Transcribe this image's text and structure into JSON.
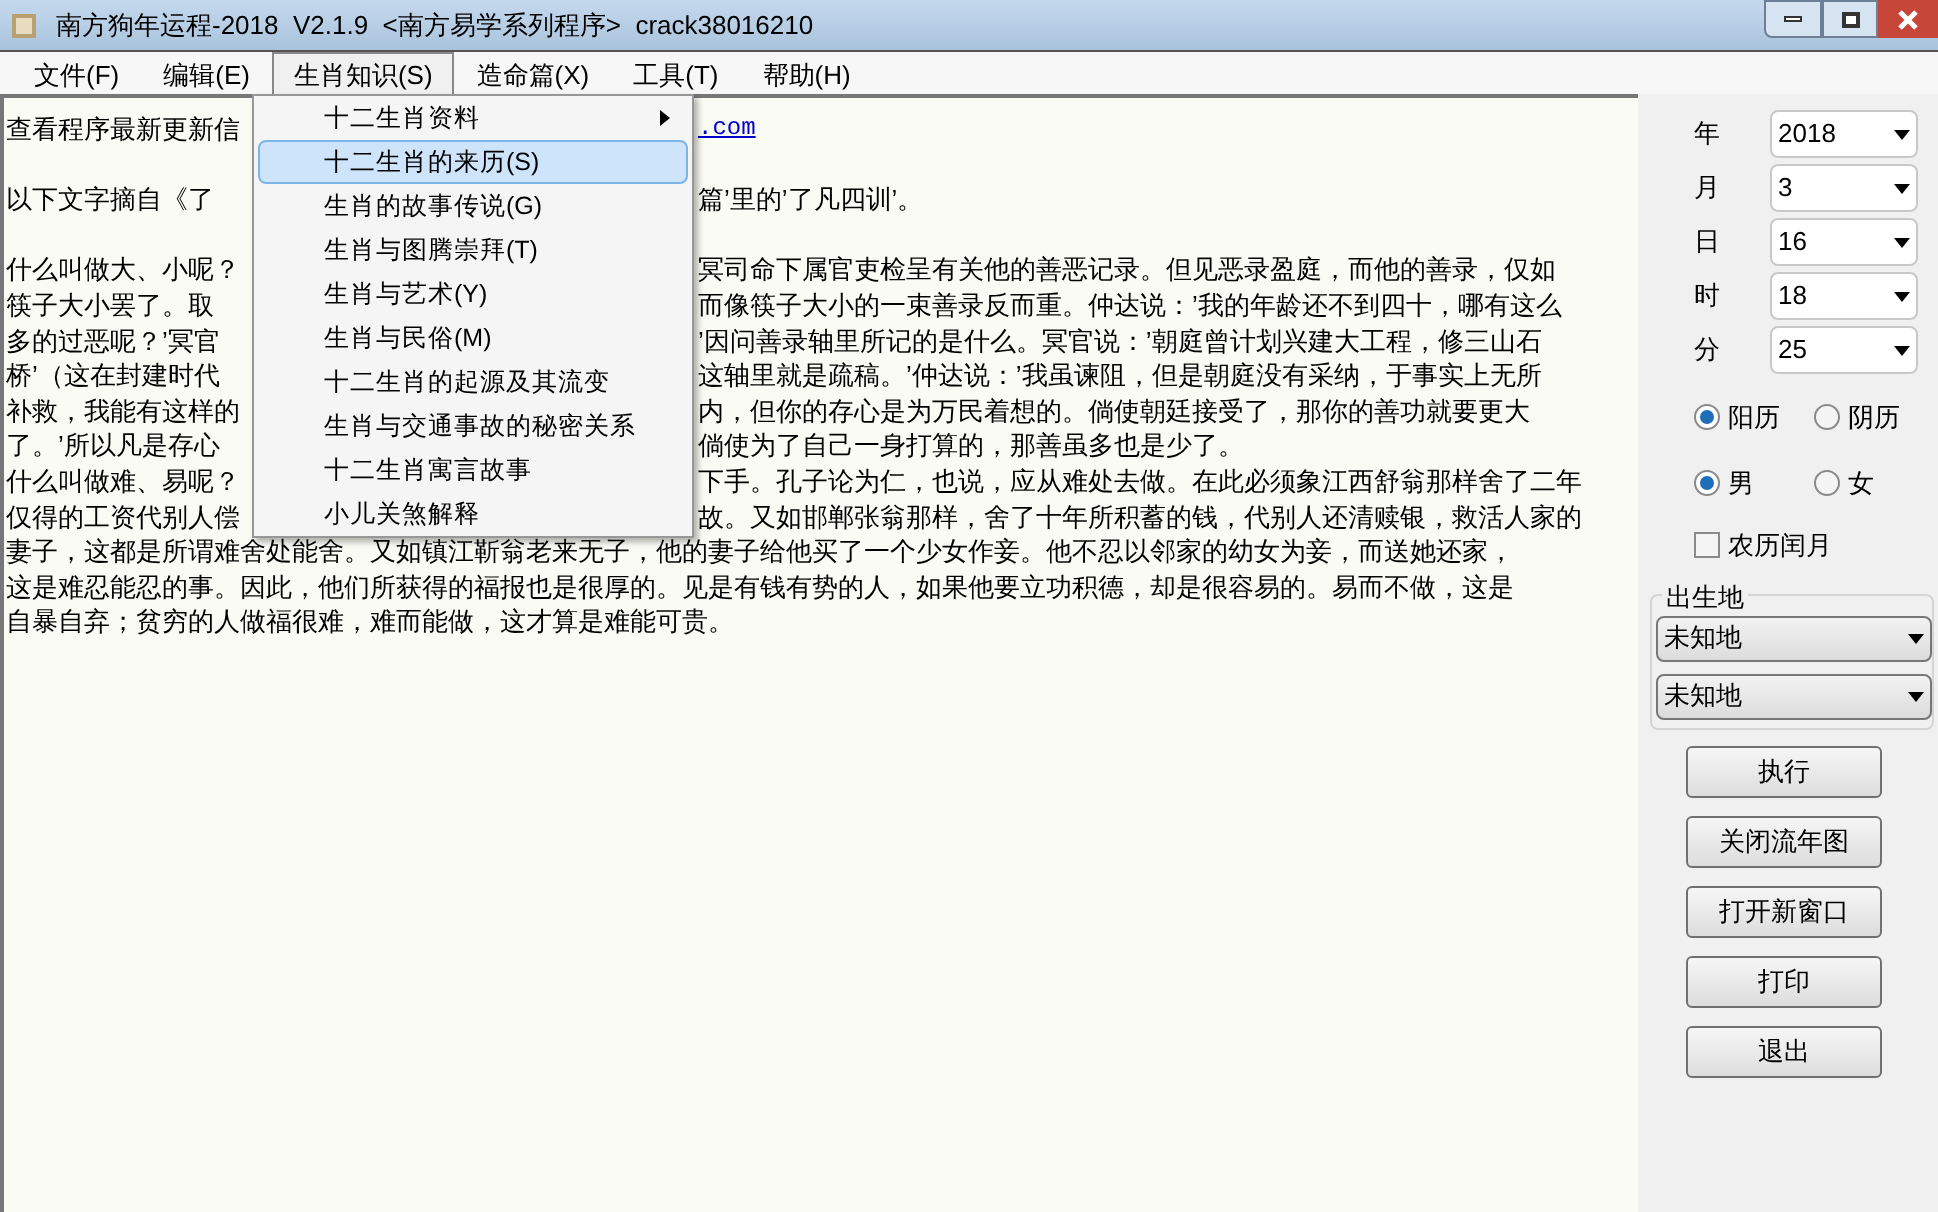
{
  "window": {
    "title": "南方狗年运程-2018  V2.1.9  <南方易学系列程序>  crack38016210"
  },
  "menu_bar": [
    {
      "label": "文件(F)",
      "selected": false
    },
    {
      "label": "编辑(E)",
      "selected": false
    },
    {
      "label": "生肖知识(S)",
      "selected": true
    },
    {
      "label": "造命篇(X)",
      "selected": false
    },
    {
      "label": "工具(T)",
      "selected": false
    },
    {
      "label": "帮助(H)",
      "selected": false
    }
  ],
  "dropdown_menu": [
    {
      "label": "十二生肖资料",
      "selected": false,
      "has_submenu": true
    },
    {
      "label": "十二生肖的来历(S)",
      "selected": true,
      "has_submenu": false
    },
    {
      "label": "生肖的故事传说(G)",
      "selected": false,
      "has_submenu": false
    },
    {
      "label": "生肖与图腾崇拜(T)",
      "selected": false,
      "has_submenu": false
    },
    {
      "label": "生肖与艺术(Y)",
      "selected": false,
      "has_submenu": false
    },
    {
      "label": "生肖与民俗(M)",
      "selected": false,
      "has_submenu": false
    },
    {
      "label": "十二生肖的起源及其流变",
      "selected": false,
      "has_submenu": false
    },
    {
      "label": "生肖与交通事故的秘密关系",
      "selected": false,
      "has_submenu": false
    },
    {
      "label": "十二生肖寓言故事",
      "selected": false,
      "has_submenu": false
    },
    {
      "label": "小儿关煞解释",
      "selected": false,
      "has_submenu": false
    }
  ],
  "text_lines": [
    {
      "left": "查看程序最新更新信",
      "right": ".com",
      "kind": "link"
    },
    {
      "kind": "blank"
    },
    {
      "left": "以下文字摘自《了",
      "right": "篇’里的’了凡四训’。",
      "kind": "text"
    },
    {
      "kind": "blank"
    },
    {
      "left": "什么叫做大、小呢？",
      "right": "冥司命下属官吏检呈有关他的善恶记录。但见恶录盈庭，而他的善录，仅如",
      "kind": "text"
    },
    {
      "left": "筷子大小罢了。取",
      "right": "而像筷子大小的一束善录反而重。仲达说：’我的年龄还不到四十，哪有这么",
      "kind": "text"
    },
    {
      "left": "多的过恶呢？’冥官",
      "right": "’因问善录轴里所记的是什么。冥官说：’朝庭曾计划兴建大工程，修三山石",
      "kind": "text"
    },
    {
      "left": "桥’（这在封建时代",
      "right": "这轴里就是疏稿。’仲达说：’我虽谏阻，但是朝庭没有采纳，于事实上无所",
      "kind": "text"
    },
    {
      "left": "补救，我能有这样的",
      "right": "内，但你的存心是为万民着想的。倘使朝廷接受了，那你的善功就要更大",
      "kind": "text"
    },
    {
      "left": "了。’所以凡是存心",
      "right": "倘使为了自己一身打算的，那善虽多也是少了。",
      "kind": "text"
    },
    {
      "left": "什么叫做难、易呢？",
      "right": "下手。孔子论为仁，也说，应从难处去做。在此必须象江西舒翁那样舍了二年",
      "kind": "text"
    },
    {
      "left": "仅得的工资代别人偿",
      "right": "故。又如邯郸张翁那样，舍了十年所积蓄的钱，代别人还清赎银，救活人家的",
      "kind": "text"
    },
    {
      "full": "妻子，这都是所谓难舍处能舍。又如镇江靳翁老来无子，他的妻子给他买了一个少女作妾。他不忍以邻家的幼女为妾，而送她还家，",
      "kind": "full"
    },
    {
      "full": "这是难忍能忍的事。因此，他们所获得的福报也是很厚的。见是有钱有势的人，如果他要立功积德，却是很容易的。易而不做，这是",
      "kind": "full"
    },
    {
      "full": "自暴自弃；贫穷的人做福很难，难而能做，这才算是难能可贵。",
      "kind": "full"
    }
  ],
  "date_fields": [
    {
      "label": "年",
      "value": "2018"
    },
    {
      "label": "月",
      "value": "3"
    },
    {
      "label": "日",
      "value": "16"
    },
    {
      "label": "时",
      "value": "18"
    },
    {
      "label": "分",
      "value": "25"
    }
  ],
  "calendar_radios": [
    {
      "label": "阳历",
      "selected": true
    },
    {
      "label": "阴历",
      "selected": false
    }
  ],
  "gender_radios": [
    {
      "label": "男",
      "selected": true
    },
    {
      "label": "女",
      "selected": false
    }
  ],
  "leap_month": {
    "label": "农历闰月",
    "checked": false
  },
  "birthplace": {
    "title": "出生地",
    "selects": [
      "未知地",
      "未知地"
    ]
  },
  "buttons": [
    "执行",
    "关闭流年图",
    "打开新窗口",
    "打印",
    "退出"
  ]
}
